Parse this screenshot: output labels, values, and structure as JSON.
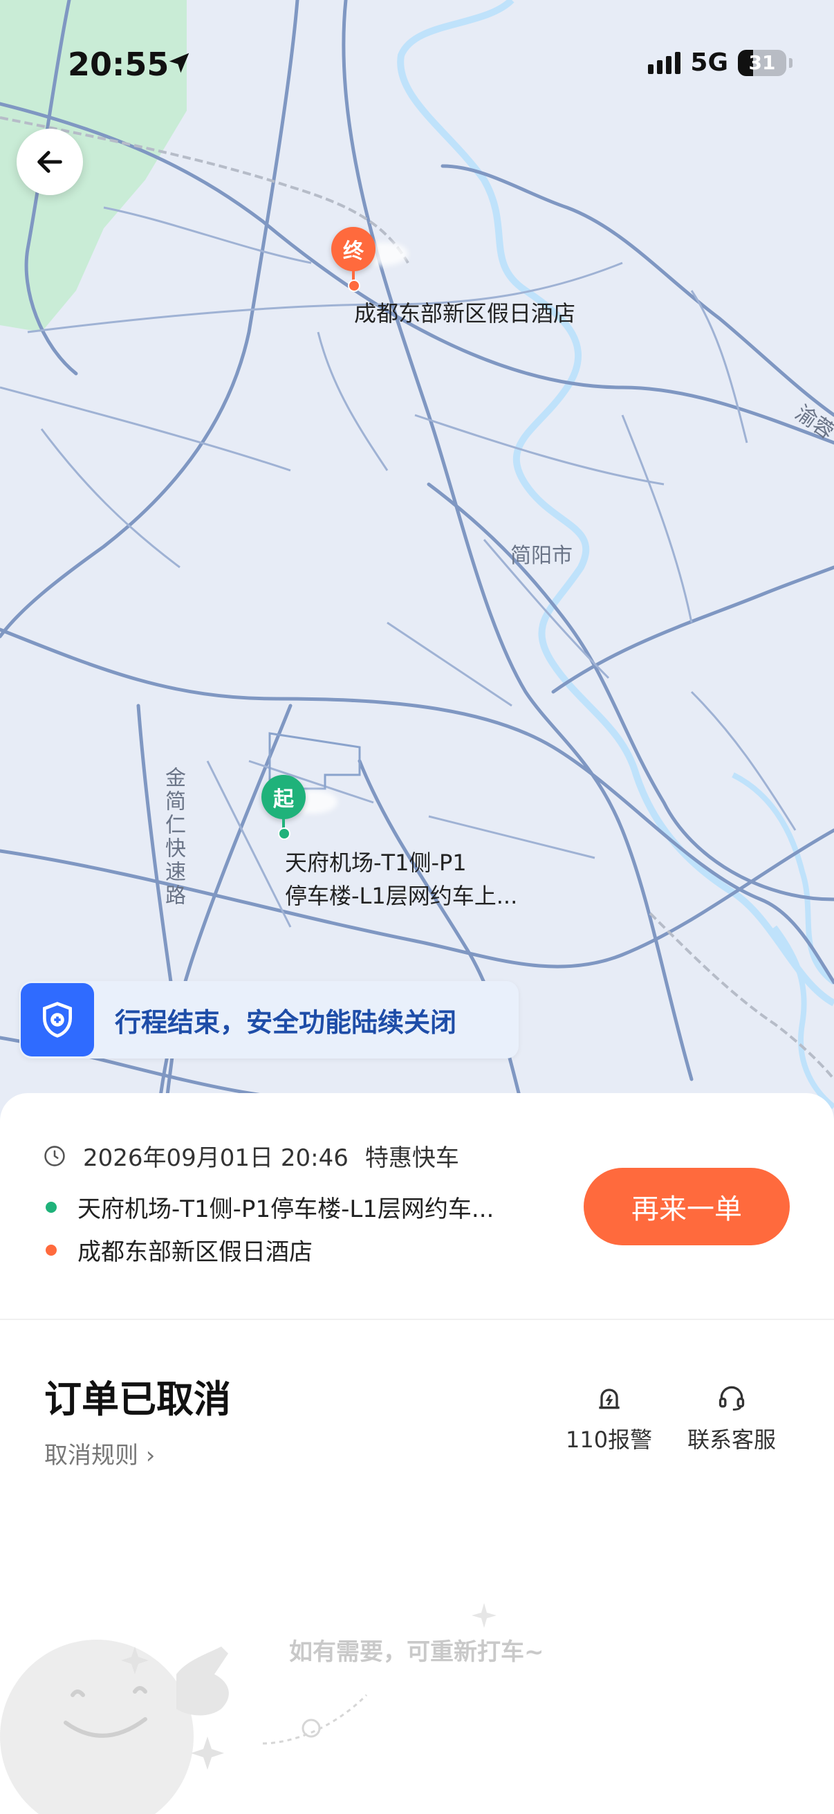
{
  "status_bar": {
    "time": "20:55",
    "network": "5G",
    "battery_percent": "31"
  },
  "map": {
    "end_pin_label": "终",
    "start_pin_label": "起",
    "destination_label": "成都东部新区假日酒店",
    "origin_label_line1": "天府机场-T1侧-P1",
    "origin_label_line2": "停车楼-L1层网约车上...",
    "city_label": "简阳市",
    "road_label_vertical": "金简仁快速路",
    "road_label_edge": "渝蓉"
  },
  "safety_banner": {
    "text": "行程结束，安全功能陆续关闭"
  },
  "order": {
    "datetime": "2026年09月01日 20:46",
    "service": "特惠快车",
    "start": "天府机场-T1侧-P1停车楼-L1层网约车...",
    "end": "成都东部新区假日酒店",
    "reorder_label": "再来一单",
    "status": "订单已取消",
    "cancel_rules": "取消规则 ›",
    "police_label": "110报警",
    "service_label": "联系客服",
    "tip": "如有需要，可重新打车~"
  },
  "colors": {
    "accent": "#ff6a3d",
    "start_green": "#1fb27a",
    "end_orange": "#ff6a3d",
    "shield_blue": "#2f6bff"
  },
  "icons": [
    "back-arrow-icon",
    "location-arrow-icon",
    "shield-plus-icon",
    "clock-icon",
    "alarm-icon",
    "headset-icon"
  ]
}
